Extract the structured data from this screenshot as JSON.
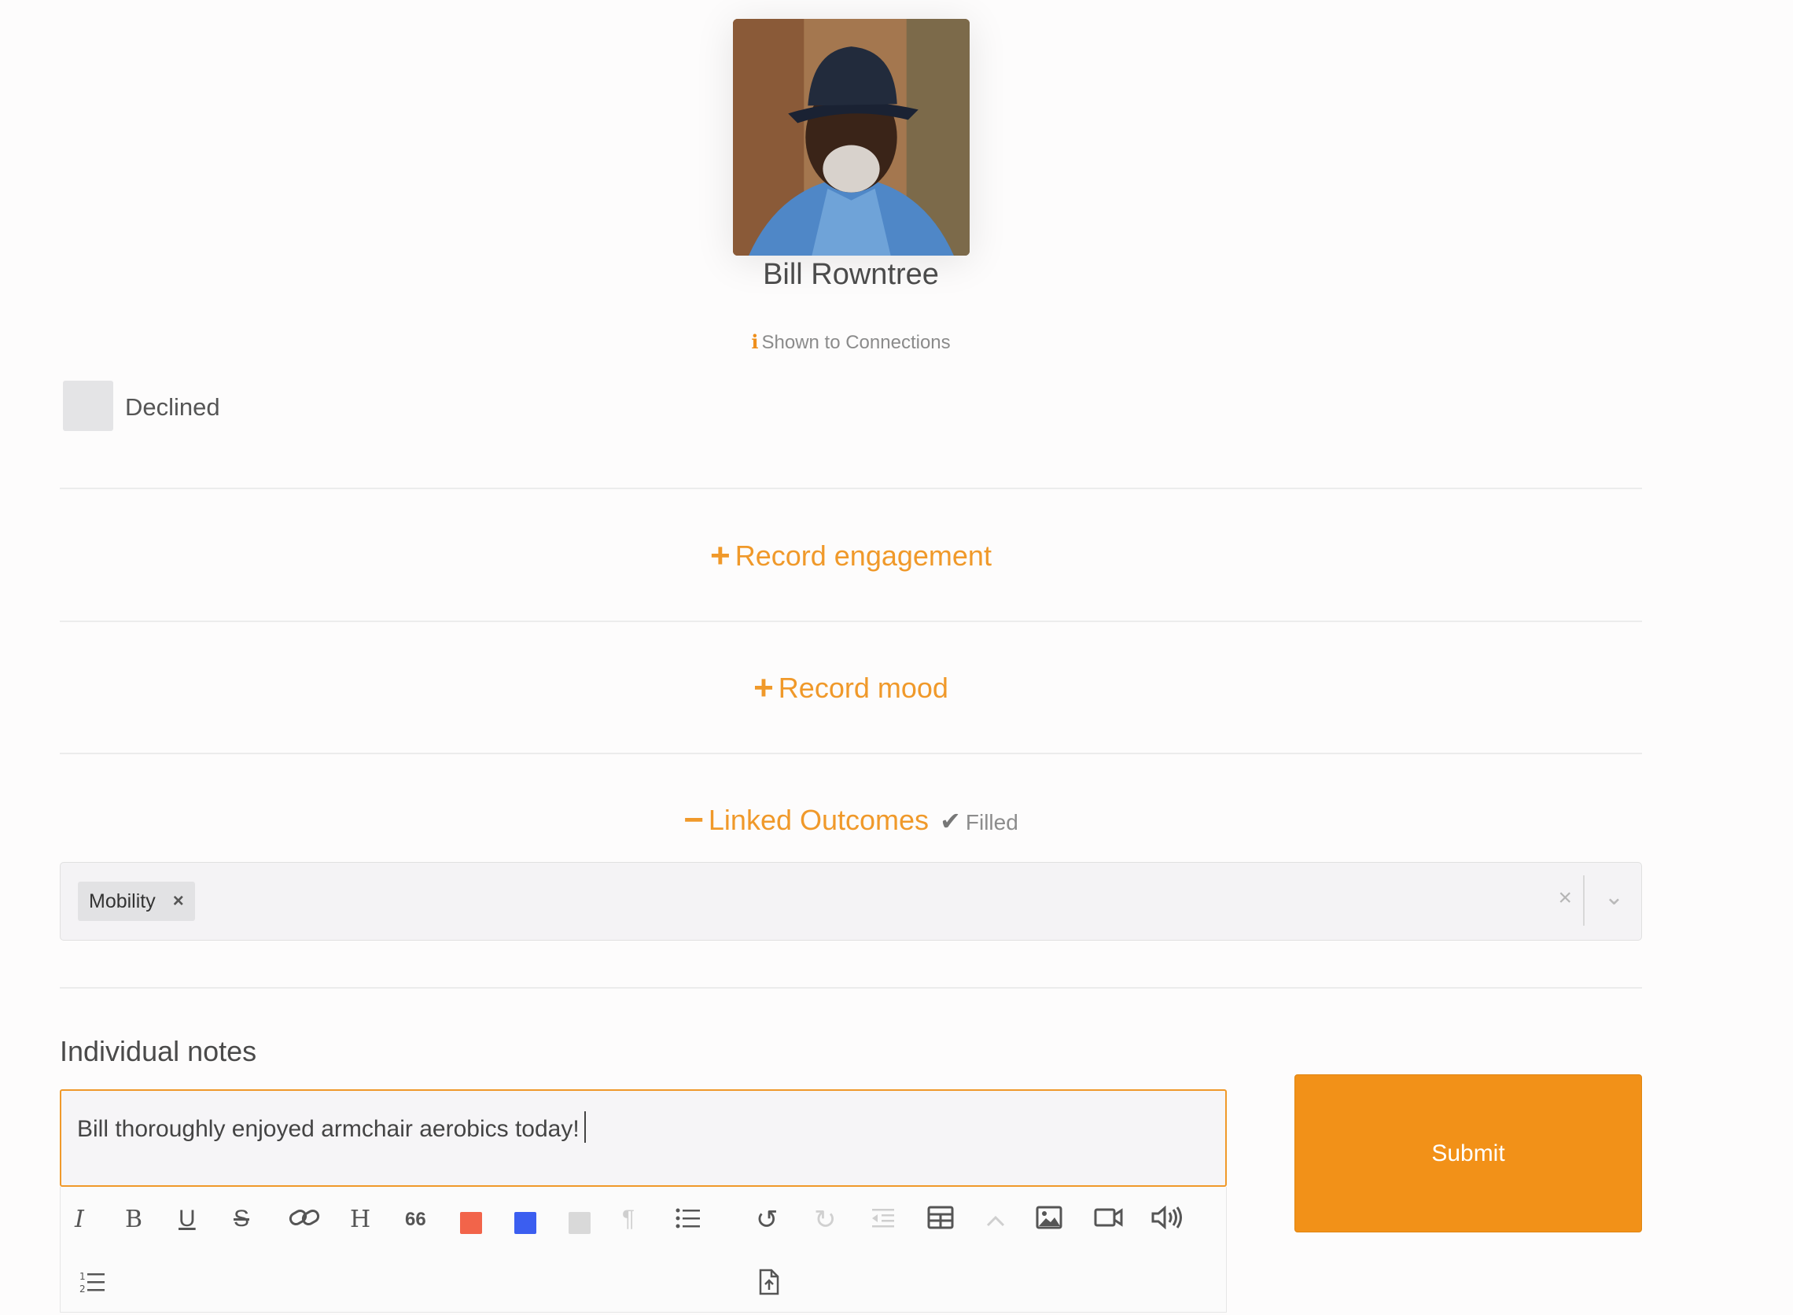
{
  "profile": {
    "name": "Bill Rowntree",
    "visibility": "Shown to Connections",
    "avatar_icon": "person-photo"
  },
  "attendance": {
    "label": "Declined",
    "checked": false
  },
  "sections": {
    "engagement": {
      "symbol": "+",
      "label": "Record engagement"
    },
    "mood": {
      "symbol": "+",
      "label": "Record mood"
    },
    "outcomes": {
      "symbol": "−",
      "label": "Linked Outcomes",
      "status_icon": "✔",
      "status": "Filled"
    }
  },
  "outcomes_select": {
    "selected": [
      "Mobility"
    ],
    "chip_remove": "×",
    "clear": "×",
    "dropdown": "⌄"
  },
  "notes": {
    "label": "Individual notes",
    "value": "Bill thoroughly enjoyed armchair aerobics today!"
  },
  "toolbar": {
    "italic": "I",
    "bold": "B",
    "underline": "U",
    "strike": "S",
    "heading": "H",
    "quote": "66",
    "paragraph": "¶",
    "undo": "↺",
    "redo": "↻",
    "colors": {
      "red": "#f2644a",
      "blue": "#3b5ef0",
      "grey": "#d9d9d9"
    }
  },
  "submit_label": "Submit",
  "accent_color": "#f0992a"
}
